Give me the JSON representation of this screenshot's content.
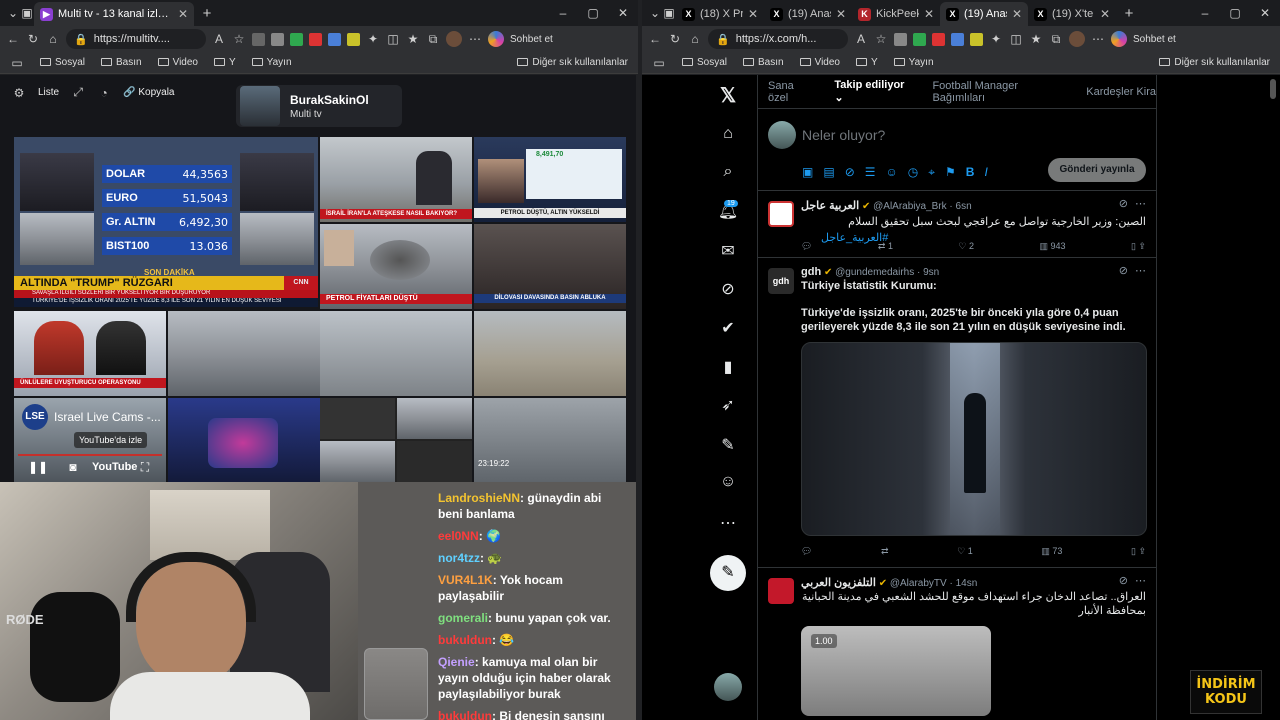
{
  "left_browser": {
    "tabs": [
      {
        "title": "Multi tv - 13 kanal izleniyor",
        "active": true
      }
    ],
    "address": "https://multitv....",
    "chat_button": "Sohbet et",
    "bookmarks": [
      "Sosyal",
      "Basın",
      "Video",
      "Y",
      "Yayın"
    ],
    "bookmarks_right": "Diğer sık kullanılanlar"
  },
  "multitv": {
    "toolbar": {
      "list_label": "Liste",
      "copy_label": "Kopyala"
    },
    "profile": {
      "name": "BurakSakinOl",
      "subtitle": "Multi tv"
    },
    "ticker": [
      {
        "name": "DOLAR",
        "value": "44,3563"
      },
      {
        "name": "EURO",
        "value": "51,5043"
      },
      {
        "name": "Gr. ALTIN",
        "value": "6,492,30"
      },
      {
        "name": "BIST100",
        "value": "13.036"
      }
    ],
    "breaking_label": "SON DAKİKA",
    "headline": "ALTINDA \"TRUMP\" RÜZGARI",
    "headline_sub": "SAVAŞLA İLGİLİ SÖZLERİ BİR YÜKSELTİYOR BİR DÜŞÜRÜYOR",
    "headline_ticker": "TÜRKİYE'DE İŞSİZLİK ORANI 2025'TE YÜZDE 8,3 İLE SON 21 YILIN EN DÜŞÜK SEVİYESİ",
    "cnn_logo": "CNN TÜRK",
    "cell_captions": {
      "israil": "İSRAİL İRAN'LA ATEŞKESE NASIL BAKIYOR?",
      "petrol_altin": "PETROL DÜŞTÜ, ALTIN YÜKSELDİ",
      "petrol": "PETROL FİYATLARI DÜŞTÜ",
      "operasyon": "ÜNLÜLERE UYUŞTURUCU OPERASYONU",
      "bina": "DİLOVASI DAVASINDA BASIN ABLUKA",
      "israel_cams": "Israel Live Cams -...",
      "lse": "LSE"
    },
    "youtube_overlay": "YouTube'da izle",
    "youtube_logo": "YouTube",
    "cam_time": "23:19:22",
    "stock_value": "8,491,70"
  },
  "webcam": {
    "mic_brand": "RØDE"
  },
  "chat": [
    {
      "user": "LandroshieNN",
      "text": "günaydin abi beni banlama",
      "cls": "u1"
    },
    {
      "user": "eel0NN",
      "text": "🌍",
      "cls": "u2"
    },
    {
      "user": "nor4tzz",
      "text": "🐢",
      "cls": "u3"
    },
    {
      "user": "VUR4L1K",
      "text": "Yok hocam paylaşabilir",
      "cls": "u4"
    },
    {
      "user": "gomerali",
      "text": "bunu yapan çok var.",
      "cls": "u5"
    },
    {
      "user": "bukuldun",
      "text": "😂",
      "cls": "u2"
    },
    {
      "user": "Qienie",
      "text": "kamuya mal olan bir yayın olduğu için haber olarak paylaşılabiliyor burak",
      "cls": "u6"
    },
    {
      "user": "bukuldun",
      "text": "Bi denesin şansını",
      "cls": "u2"
    }
  ],
  "right_browser": {
    "tabs": [
      {
        "title": "(18) X Pro"
      },
      {
        "title": "(19) Anasayfa"
      },
      {
        "title": "KickPeek - Ki"
      },
      {
        "title": "(19) Anasayfa",
        "active": true
      },
      {
        "title": "(19) X'te Laura"
      }
    ],
    "address": "https://x.com/h...",
    "chat_button": "Sohbet et",
    "bookmarks": [
      "Sosyal",
      "Basın",
      "Video",
      "Y",
      "Yayın"
    ],
    "bookmarks_right": "Diğer sık kullanılanlar"
  },
  "x": {
    "notification_count": "19",
    "tabs": [
      "Sana özel",
      "Takip ediliyor",
      "Football Manager Bağımlıları",
      "Kardeşler Kira"
    ],
    "compose_placeholder": "Neler oluyor?",
    "post_button": "Gönderi yayınla",
    "posts": [
      {
        "name": "العربية عاجل",
        "handle": "@AlArabiya_Brk · 6sn",
        "text": "الصين: وزير الخارجية تواصل مع عراقجي لبحث سبل تحقيق السلام",
        "hashtag": "#العربية_عاجل",
        "replies": "",
        "reposts": "1",
        "likes": "2",
        "views": "943"
      },
      {
        "name": "gdh",
        "handle": "@gundemedairhs · 9sn",
        "title": "Türkiye İstatistik Kurumu:",
        "text": "Türkiye'de işsizlik oranı, 2025'te bir önceki yıla göre 0,4 puan gerileyerek yüzde 8,3 ile son 21 yılın en düşük seviyesine indi.",
        "replies": "",
        "reposts": "",
        "likes": "1",
        "views": "73"
      },
      {
        "name": "التلفزيون العربي",
        "handle": "@AlarabyTV · 14sn",
        "text": "العراق.. تصاعد الدخان جراء استهداف موقع للحشد الشعبي في مدينة الحبانية بمحافظة الأنبار",
        "video_speed": "1.00"
      }
    ]
  },
  "overlay_badge": {
    "line1": "İNDİRİM",
    "line2": "KODU"
  }
}
